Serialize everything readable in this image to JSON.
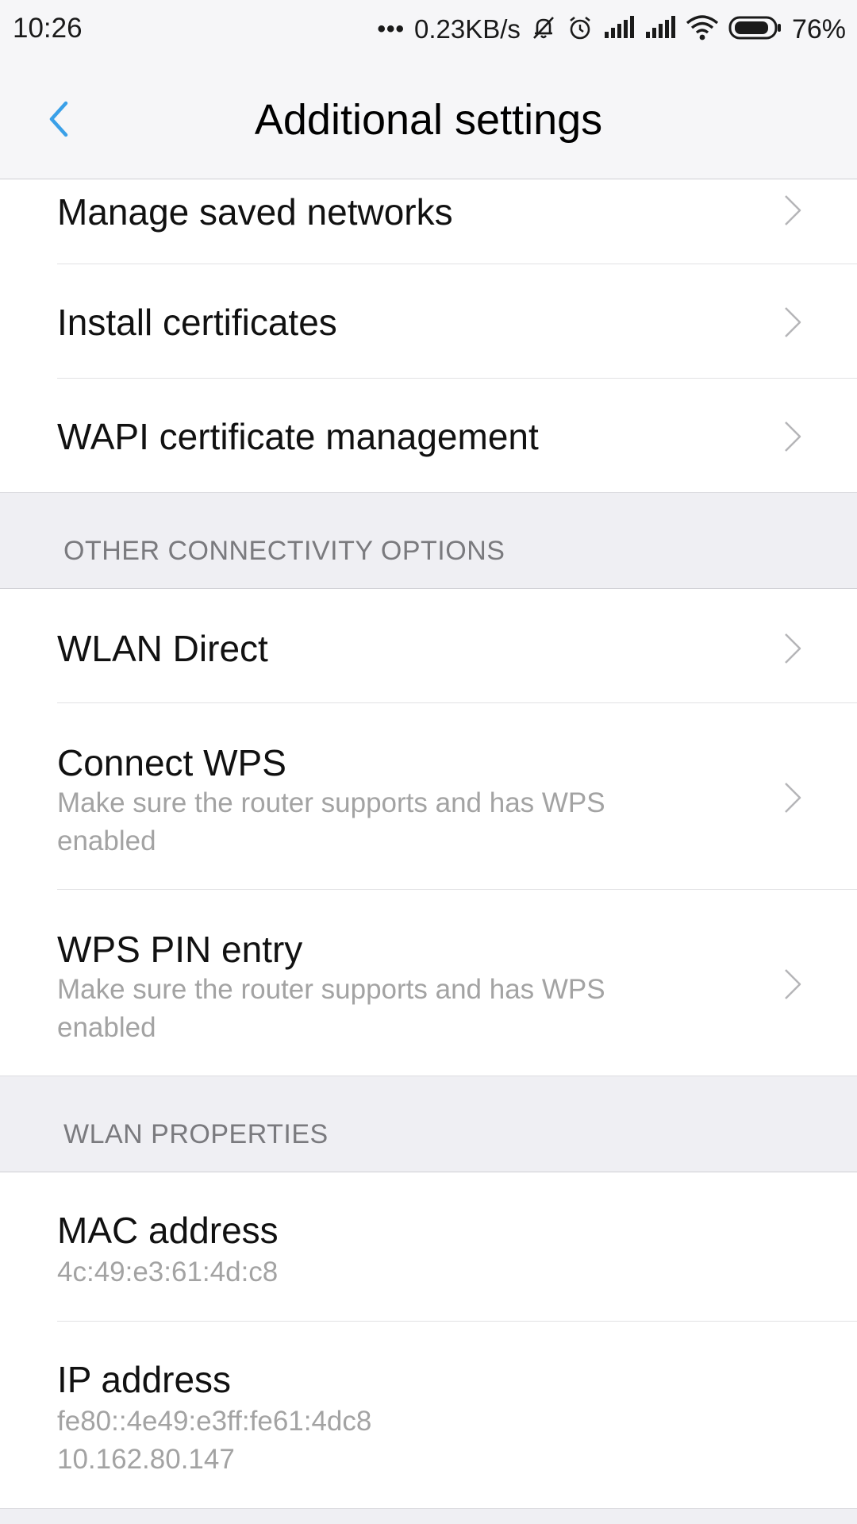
{
  "status_bar": {
    "time": "10:26",
    "dots": "•••",
    "network_speed": "0.23KB/s",
    "battery_percent": "76%",
    "icons": [
      "mute-bell-icon",
      "alarm-icon",
      "signal-icon",
      "signal-icon",
      "wifi-icon",
      "battery-icon"
    ]
  },
  "header": {
    "title": "Additional  settings",
    "back_icon": "chevron-left-icon"
  },
  "accent_color": "#3aa0e8",
  "rows_top": [
    {
      "title": "Manage saved networks"
    },
    {
      "title": "Install certificates"
    },
    {
      "title": "WAPI certificate management"
    }
  ],
  "section_other": {
    "label": "OTHER CONNECTIVITY OPTIONS",
    "rows": [
      {
        "title": "WLAN Direct"
      },
      {
        "title": "Connect WPS",
        "subtitle": "Make sure the router supports and has WPS enabled"
      },
      {
        "title": "WPS PIN entry",
        "subtitle": "Make sure the router supports and has WPS enabled"
      }
    ]
  },
  "section_props": {
    "label": "WLAN PROPERTIES",
    "mac": {
      "title": "MAC address",
      "value": "4c:49:e3:61:4d:c8"
    },
    "ip": {
      "title": "IP address",
      "value_ipv6": "fe80::4e49:e3ff:fe61:4dc8",
      "value_ipv4": "10.162.80.147"
    }
  }
}
